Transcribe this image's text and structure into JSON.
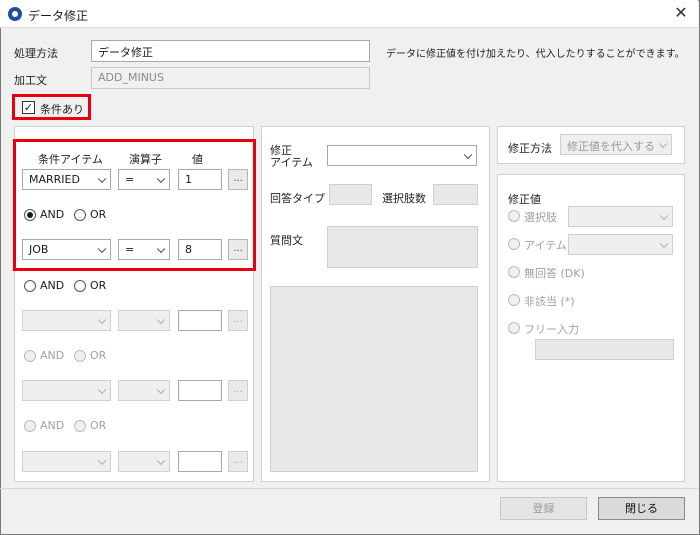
{
  "window": {
    "title": "データ修正",
    "close": "✕"
  },
  "form": {
    "process_label": "処理方法",
    "process_value": "データ修正",
    "description": "データに修正値を付け加えたり、代入したりすることができます。",
    "processing_label": "加工文",
    "processing_value": "ADD_MINUS",
    "condition_label": "条件あり",
    "condition_checked": true
  },
  "conditions": {
    "headers": {
      "item": "条件アイテム",
      "operator": "演算子",
      "value": "値"
    },
    "rows": [
      {
        "item": "MARRIED",
        "operator": "=",
        "value": "1",
        "enabled": true
      },
      {
        "item": "JOB",
        "operator": "=",
        "value": "8",
        "enabled": true
      },
      {
        "item": "",
        "operator": "",
        "value": "",
        "enabled": false
      },
      {
        "item": "",
        "operator": "",
        "value": "",
        "enabled": false
      }
    ],
    "connectors": [
      {
        "and": "AND",
        "or": "OR",
        "selected": "AND",
        "enabled": true
      },
      {
        "and": "AND",
        "or": "OR",
        "selected": "",
        "enabled": true
      },
      {
        "and": "AND",
        "or": "OR",
        "selected": "",
        "enabled": false
      },
      {
        "and": "AND",
        "or": "OR",
        "selected": "",
        "enabled": false
      }
    ],
    "dots": "..."
  },
  "middle": {
    "edit_item_label": "修正\nアイテム",
    "answer_type_label": "回答タイプ",
    "choice_count_label": "選択肢数",
    "question_label": "質問文"
  },
  "right": {
    "method_label": "修正方法",
    "method_value": "修正値を代入する",
    "value_title": "修正値",
    "options": [
      {
        "label": "選択肢",
        "has_select": true
      },
      {
        "label": "アイテム",
        "has_select": true
      },
      {
        "label": "無回答 (DK)",
        "has_select": false
      },
      {
        "label": "非該当 (*)",
        "has_select": false
      },
      {
        "label": "フリー入力",
        "has_select": false
      }
    ]
  },
  "footer": {
    "register": "登録",
    "close": "閉じる"
  }
}
